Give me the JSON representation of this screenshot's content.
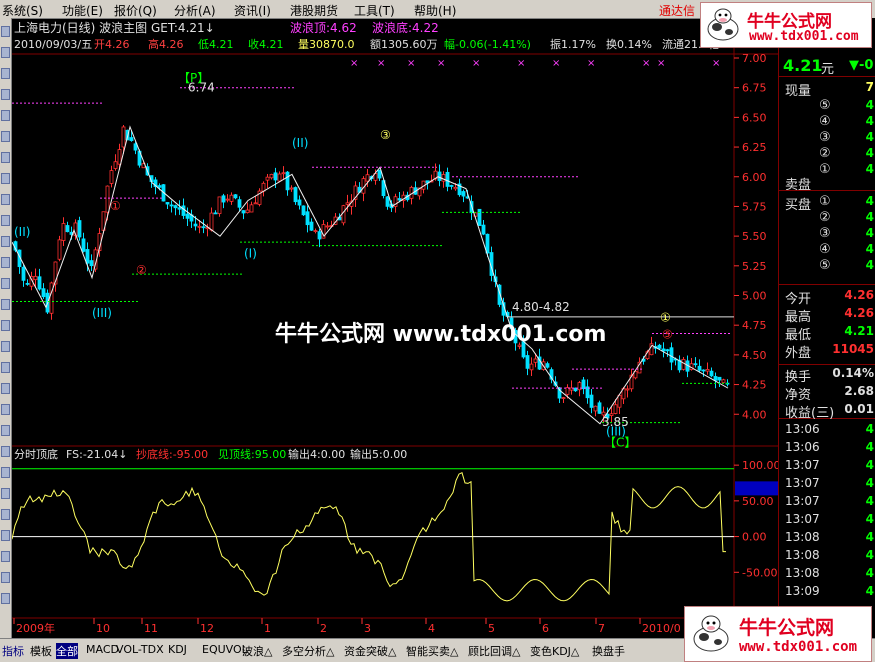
{
  "menu": {
    "items": [
      "系统(S)",
      "功能(E)",
      "报价(Q)",
      "分析(A)",
      "资讯(I)",
      "港股期货",
      "工具(T)",
      "帮助(H)"
    ],
    "brand": "通达信"
  },
  "chart_header": {
    "line1": "上海电力(日线) 波浪主图  GET:4.21↓",
    "wave_top": "波浪顶:4.62",
    "wave_bottom": "波浪底:4.22",
    "line2_date": "2010/09/03/五",
    "line2_open": "开4.26",
    "line2_high": "高4.26",
    "line2_low": "低4.21",
    "line2_close": "收4.21",
    "line2_vol": "量30870.0",
    "line2_amt": "额1305.60万",
    "line2_chg": "幅-0.06(-1.41%)",
    "line2_amp": "振1.17%",
    "line2_turn": "换0.14%",
    "line2_float": "流通21.4亿"
  },
  "price_axis": [
    "7.00",
    "6.75",
    "6.50",
    "6.25",
    "6.00",
    "5.75",
    "5.50",
    "5.25",
    "5.00",
    "4.75",
    "4.50",
    "4.25",
    "4.00"
  ],
  "annotations": {
    "p_tag": "【P】",
    "top_price": "6.74",
    "wave_ii_1": "(II)",
    "wave_ii_2": "(II)",
    "wave_iii": "(III)",
    "wave_i": "(I)",
    "circle_1": "①",
    "circle_2": "②",
    "circle_3": "③",
    "circle_1b": "①",
    "circle_5": "⑤",
    "range_label": "4.80-4.82",
    "low_price": "3.85",
    "wave_iii_2": "(III)",
    "c_tag": "【C】"
  },
  "indicator_header": {
    "name": "分时顶底",
    "fs": "FS:-21.04↓",
    "bottom_line": "抄底线:-95.00",
    "top_line": "见顶线:95.00",
    "out4": "输出4:0.00",
    "out5": "输出5:0.00"
  },
  "indicator_axis": [
    "100.00",
    "50.00",
    "0.00",
    "-50.00"
  ],
  "indicator_value": "67.49",
  "date_axis": [
    "2009年",
    "10",
    "11",
    "12",
    "1",
    "2",
    "3",
    "4",
    "5",
    "6",
    "7",
    "2010/0"
  ],
  "right_panel": {
    "price": "4.21",
    "price_unit": "元",
    "arrow": "▼-0",
    "now_vol_label": "现量",
    "now_vol_value": "7",
    "sell_label": "卖盘",
    "buy_label": "买盘",
    "sell_levels": [
      "⑤",
      "④",
      "③",
      "②",
      "①"
    ],
    "buy_levels": [
      "①",
      "②",
      "③",
      "④",
      "⑤"
    ],
    "sell_values": [
      "4",
      "4",
      "4",
      "4",
      "4"
    ],
    "buy_values": [
      "4",
      "4",
      "4",
      "4",
      "4"
    ],
    "stats": [
      {
        "label": "今开",
        "value": "4.26"
      },
      {
        "label": "最高",
        "value": "4.26"
      },
      {
        "label": "最低",
        "value": "4.21"
      },
      {
        "label": "外盘",
        "value": "11045"
      },
      {
        "label": "换手",
        "value": "0.14%"
      },
      {
        "label": "净资",
        "value": "2.68"
      },
      {
        "label": "收益(三)",
        "value": "0.01"
      }
    ],
    "ticks": [
      {
        "time": "13:06",
        "value": "4"
      },
      {
        "time": "13:06",
        "value": "4"
      },
      {
        "time": "13:07",
        "value": "4"
      },
      {
        "time": "13:07",
        "value": "4"
      },
      {
        "time": "13:07",
        "value": "4"
      },
      {
        "time": "13:07",
        "value": "4"
      },
      {
        "time": "13:08",
        "value": "4"
      },
      {
        "time": "13:08",
        "value": "4"
      },
      {
        "time": "13:08",
        "value": "4"
      },
      {
        "time": "13:09",
        "value": "4"
      }
    ]
  },
  "bottom_tabs": [
    "指标",
    "模板",
    "全部",
    "MACD",
    "VOL-TDX",
    "KDJ",
    "EQUVOL",
    "波浪△",
    "多空分析△",
    "资金突破△",
    "智能买卖△",
    "顾比回调△",
    "变色KDJ△",
    "换盘手"
  ],
  "watermark": "牛牛公式网 www.tdx001.com",
  "logo": {
    "name": "牛牛公式网",
    "url": "www.tdx001.com"
  },
  "colors": {
    "up": "#ff3030",
    "down": "#00e0ff",
    "yellow": "#ffff60",
    "green": "#00ff00",
    "magenta": "#ff40ff"
  },
  "chart_data": {
    "type": "candlestick",
    "ylim": [
      3.8,
      7.0
    ],
    "indicator_ylim": [
      -100,
      110
    ],
    "x_labels": [
      "2009年",
      "10",
      "11",
      "12",
      "1",
      "2",
      "3",
      "4",
      "5",
      "6",
      "7",
      "2010/0"
    ]
  }
}
